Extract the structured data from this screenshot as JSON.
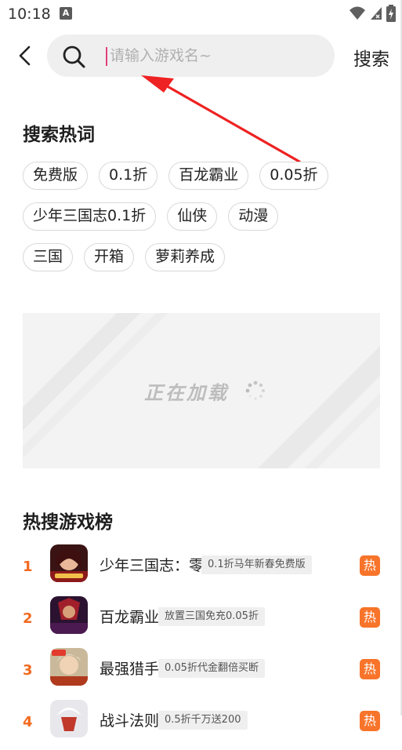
{
  "status_bar": {
    "time": "10:18",
    "notification_glyph": "A"
  },
  "search": {
    "placeholder": "请输入游戏名~",
    "value": "",
    "button_label": "搜索"
  },
  "hot_words": {
    "title": "搜索热词",
    "rows": [
      [
        "免费版",
        "0.1折",
        "百龙霸业",
        "0.05折"
      ],
      [
        "少年三国志0.1折",
        "仙侠",
        "动漫"
      ],
      [
        "三国",
        "开箱",
        "萝莉养成"
      ]
    ]
  },
  "banner": {
    "loading_text": "正在加载"
  },
  "hot_games": {
    "title": "热搜游戏榜",
    "items": [
      {
        "rank": "1",
        "name": "少年三国志：零",
        "tag": "0.1折马年新春免费版",
        "badge": "热"
      },
      {
        "rank": "2",
        "name": "百龙霸业",
        "tag": "放置三国免充0.05折",
        "badge": "热"
      },
      {
        "rank": "3",
        "name": "最强猎手",
        "tag": "0.05折代金翻倍买断",
        "badge": "热"
      },
      {
        "rank": "4",
        "name": "战斗法则",
        "tag": "0.5折千万送200",
        "badge": "热"
      }
    ]
  },
  "colors": {
    "accent": "#f26a1f",
    "hot_badge": "#f7742a",
    "arrow": "#ee2222",
    "chip_border": "#d9d9d9"
  }
}
